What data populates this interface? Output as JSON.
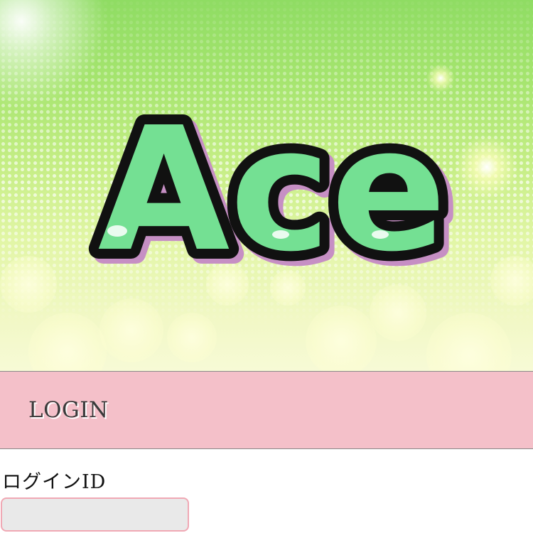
{
  "hero": {
    "logo_text": "Ace",
    "colors": {
      "background_top": "#8fdc63",
      "background_bottom": "#f7fad6",
      "logo_fill": "#74e093",
      "logo_outline": "#111111",
      "logo_shadow": "#c68fc4"
    }
  },
  "login": {
    "title": "LOGIN",
    "band_color": "#f4c0c9"
  },
  "form": {
    "login_id_label": "ログインID",
    "login_id_value": "",
    "login_id_placeholder": ""
  }
}
